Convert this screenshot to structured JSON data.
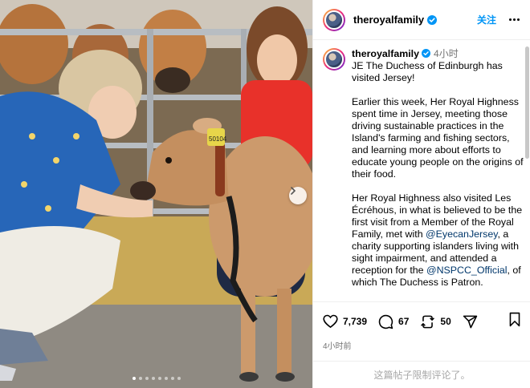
{
  "post": {
    "username": "theroyalfamily",
    "follow_label": "关注",
    "caption_author": "theroyalfamily",
    "caption_time": "4小时",
    "caption_line1": "JE The Duchess of Edinburgh has visited Jersey!",
    "para2": "Earlier this week, Her Royal Highness spent time in Jersey, meeting those driving sustainable practices in the Island's farming and fishing sectors, and learning more about efforts to educate young people on the origins of their food.",
    "para3_a": "Her Royal Highness also visited Les Écréhous, in what is believed to be the first visit from a Member of the Royal Family, met with ",
    "mention1": "@EyecanJersey",
    "para3_b": ", a charity supporting islanders living with sight impairment, and attended a reception for the ",
    "mention2": "@NSPCC_Official",
    "para3_c": ", of which The Duchess is Patron.",
    "likes": "7,739",
    "comments": "67",
    "reposts": "50",
    "timestamp": "4小时前",
    "comments_off": "这篇帖子限制评论了。",
    "calf_tag": "50104"
  },
  "colors": {
    "accent": "#0095f6",
    "verified": "#0095f6",
    "link": "#00376b"
  },
  "icons": {
    "verified": "verified-badge-icon",
    "more": "more-options-icon",
    "like": "heart-icon",
    "comment": "comment-bubble-icon",
    "repost": "repost-icon",
    "share": "send-icon",
    "save": "bookmark-icon",
    "next": "chevron-right-icon"
  },
  "carousel": {
    "slide_count": 8,
    "active_index": 0
  }
}
